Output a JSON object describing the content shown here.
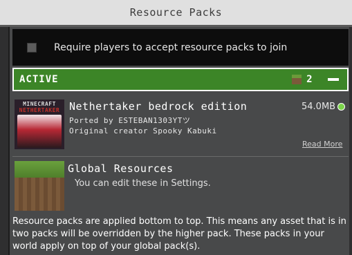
{
  "title": "Resource Packs",
  "require": {
    "label": "Require players to accept resource packs to join",
    "checked": false
  },
  "active": {
    "label": "ACTIVE",
    "count": "2"
  },
  "pack": {
    "thumb_title": "MINECRAFT",
    "thumb_subtitle": "NETHERTAKER",
    "name": "Nethertaker bedrock edition",
    "ported_by": "Ported by ESTEBAN1303YTツ",
    "original_creator": "Original creator Spooky Kabuki",
    "size": "54.0MB",
    "read_more": "Read More"
  },
  "global": {
    "name": "Global Resources",
    "subtitle": "You can edit these in Settings."
  },
  "footer": "Resource packs are applied bottom to top. This means any asset that is in two packs will be overridden by the higher pack. These packs in your world apply on top of your global pack(s).",
  "colors": {
    "active_green": "#3c8527",
    "status_green": "#7bd44a"
  }
}
